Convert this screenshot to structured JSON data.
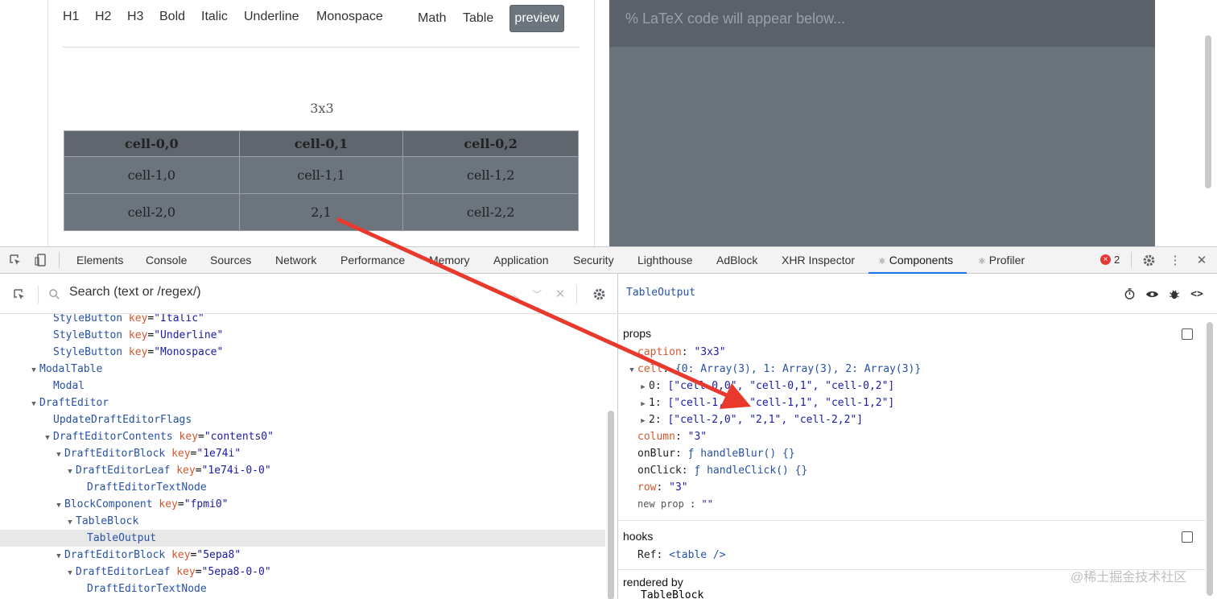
{
  "toolbar": {
    "h1": "H1",
    "h2": "H2",
    "h3": "H3",
    "bold": "Bold",
    "italic": "Italic",
    "underline": "Underline",
    "monospace": "Monospace",
    "math": "Math",
    "table": "Table",
    "preview": "preview"
  },
  "table": {
    "caption": "3x3",
    "header": [
      "cell-0,0",
      "cell-0,1",
      "cell-0,2"
    ],
    "rows": [
      [
        "cell-1,0",
        "cell-1,1",
        "cell-1,2"
      ],
      [
        "cell-2,0",
        "2,1",
        "cell-2,2"
      ]
    ]
  },
  "latex": {
    "placeholder": "% LaTeX code will appear below..."
  },
  "devtools": {
    "tabs": [
      "Elements",
      "Console",
      "Sources",
      "Network",
      "Performance",
      "Memory",
      "Application",
      "Security",
      "Lighthouse",
      "AdBlock",
      "XHR Inspector",
      "Components",
      "Profiler"
    ],
    "components_prefix": "⚛",
    "error_count": "2",
    "search_placeholder": "Search (text or /regex/)",
    "tree": [
      {
        "name": "StyleButton",
        "key": "key",
        "val": "\"Italic\""
      },
      {
        "name": "StyleButton",
        "key": "key",
        "val": "\"Underline\""
      },
      {
        "name": "StyleButton",
        "key": "key",
        "val": "\"Monospace\""
      },
      {
        "name": "ModalTable"
      },
      {
        "name": "Modal"
      },
      {
        "name": "DraftEditor"
      },
      {
        "name": "UpdateDraftEditorFlags"
      },
      {
        "name": "DraftEditorContents",
        "key": "key",
        "val": "\"contents0\""
      },
      {
        "name": "DraftEditorBlock",
        "key": "key",
        "val": "\"1e74i\""
      },
      {
        "name": "DraftEditorLeaf",
        "key": "key",
        "val": "\"1e74i-0-0\""
      },
      {
        "name": "DraftEditorTextNode"
      },
      {
        "name": "BlockComponent",
        "key": "key",
        "val": "\"fpmi0\""
      },
      {
        "name": "TableBlock"
      },
      {
        "name": "TableOutput"
      },
      {
        "name": "DraftEditorBlock",
        "key": "key",
        "val": "\"5epa8\""
      },
      {
        "name": "DraftEditorLeaf",
        "key": "key",
        "val": "\"5epa8-0-0\""
      },
      {
        "name": "DraftEditorTextNode"
      }
    ],
    "selected_component": "TableOutput",
    "props_title": "props",
    "props": {
      "caption_key": "caption",
      "caption_val": "\"3x3\"",
      "cell_key": "cell",
      "cell_summary": "{0: Array(3), 1: Array(3), 2: Array(3)}",
      "cell_rows": [
        {
          "idx": "0",
          "val": "[\"cell-0,0\", \"cell-0,1\", \"cell-0,2\"]"
        },
        {
          "idx": "1",
          "val": "[\"cell-1,0\", \"cell-1,1\", \"cell-1,2\"]"
        },
        {
          "idx": "2",
          "val": "[\"cell-2,0\", \"2,1\", \"cell-2,2\"]"
        }
      ],
      "column_key": "column",
      "column_val": "\"3\"",
      "onblur_key": "onBlur",
      "onblur_val": "ƒ handleBlur() {}",
      "onclick_key": "onClick",
      "onclick_val": "ƒ handleClick() {}",
      "row_key": "row",
      "row_val": "\"3\"",
      "new_prop_key": "new prop",
      "new_prop_val": "\"\""
    },
    "hooks_title": "hooks",
    "hooks": {
      "ref_key": "Ref",
      "ref_val": "<table />"
    },
    "rendered_by_title": "rendered by",
    "rendered_by": "TableBlock"
  },
  "watermark": "@稀土掘金技术社区",
  "colors": {
    "arrow": "#e8392c",
    "accent": "#1a73e8",
    "preview_bg": "#6c757d"
  }
}
